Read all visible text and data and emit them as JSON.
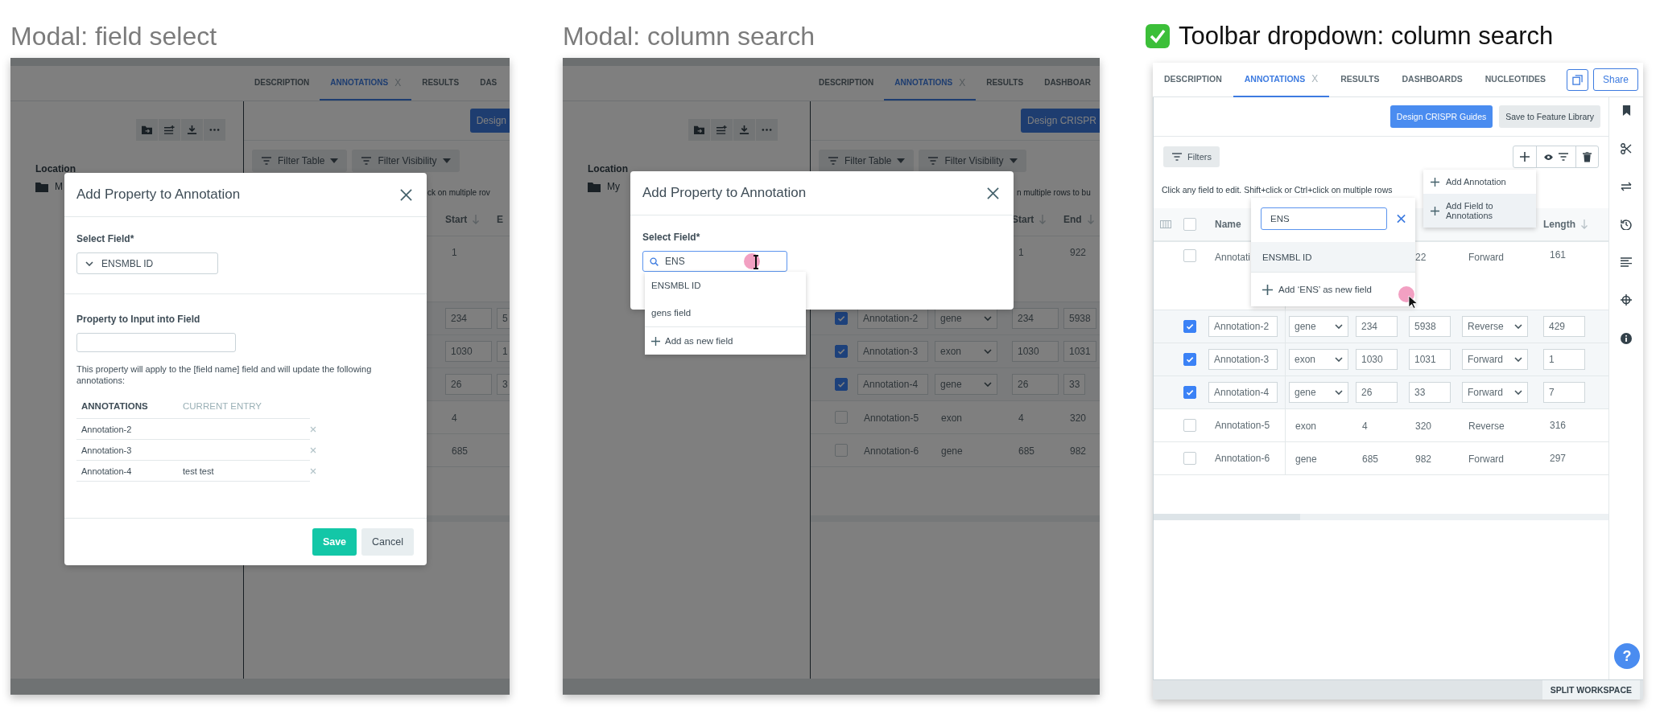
{
  "field_select": {
    "heading": "Modal: field select",
    "tabs": [
      {
        "label": "DESCRIPTION",
        "selected": false
      },
      {
        "label": "ANNOTATIONS",
        "selected": true,
        "close": "X"
      },
      {
        "label": "RESULTS",
        "selected": false
      },
      {
        "label": "DAS",
        "selected": false
      }
    ],
    "primary_button": "Design",
    "location_label": "Location",
    "folder": "M",
    "filters": [
      "Filter Table",
      "Filter Visibility"
    ],
    "hint": "ck on multiple rov",
    "columns": [
      {
        "label": "Start",
        "sort": true
      },
      {
        "label": "E",
        "sort": false
      }
    ],
    "rows": [
      {
        "editable": false,
        "start": "1"
      },
      {
        "editable": true,
        "start": "234",
        "end": "5"
      },
      {
        "editable": true,
        "start": "1030",
        "end": "1"
      },
      {
        "editable": true,
        "start": "26",
        "end": "3"
      },
      {
        "editable": false,
        "start": "4"
      },
      {
        "editable": false,
        "start": "685"
      }
    ],
    "modal": {
      "title": "Add Property to Annotation",
      "select_label": "Select Field*",
      "select_value": "ENSMBL ID",
      "input_label": "Property to Input into Field",
      "note": "This property will apply to the [field name] field and will update the following annotations:",
      "columns": [
        "ANNOTATIONS",
        "CURRENT ENTRY"
      ],
      "entries": [
        {
          "annotation": "Annotation-2"
        },
        {
          "annotation": "Annotation-3"
        },
        {
          "annotation": "Annotation-4",
          "current": "test test"
        }
      ],
      "buttons": [
        {
          "label": "Save",
          "kind": "primary"
        },
        {
          "label": "Cancel",
          "kind": "secondary"
        }
      ]
    }
  },
  "column_search": {
    "heading": "Modal: column search",
    "tabs": [
      {
        "label": "DESCRIPTION",
        "selected": false
      },
      {
        "label": "ANNOTATIONS",
        "selected": true,
        "close": "X"
      },
      {
        "label": "RESULTS",
        "selected": false
      },
      {
        "label": "DASHBOAR",
        "selected": false
      }
    ],
    "primary_button": "Design CRISPR",
    "location_label": "Location",
    "folder": "My",
    "filters": [
      "Filter Table",
      "Filter Visibility"
    ],
    "hint": "n multiple rows to bu",
    "columns": [
      {
        "label": "Start",
        "sort": true
      },
      {
        "label": "End",
        "sort": true
      }
    ],
    "rows": [
      {
        "editable": false,
        "start": "1",
        "end": "922"
      },
      {
        "checked": true,
        "editable": true,
        "name": "Annotation-2",
        "type": "gene",
        "start": "234",
        "end": "5938"
      },
      {
        "checked": true,
        "editable": true,
        "name": "Annotation-3",
        "type": "exon",
        "start": "1030",
        "end": "1031"
      },
      {
        "checked": true,
        "editable": true,
        "name": "Annotation-4",
        "type": "gene",
        "start": "26",
        "end": "33"
      },
      {
        "checked": false,
        "editable": false,
        "name": "Annotation-5",
        "type": "exon",
        "start": "4",
        "end": "320"
      },
      {
        "checked": false,
        "editable": false,
        "name": "Annotation-6",
        "type": "gene",
        "start": "685",
        "end": "982"
      }
    ],
    "modal": {
      "title": "Add Property to Annotation",
      "select_label": "Select Field*",
      "search_value": "ENS",
      "options": [
        {
          "label": "ENSMBL ID"
        },
        {
          "label": "gens field"
        }
      ],
      "add_option": "Add as new field"
    }
  },
  "toolbar_dropdown": {
    "heading": "Toolbar dropdown: column search",
    "approved": true,
    "tabs": [
      {
        "label": "DESCRIPTION",
        "selected": false
      },
      {
        "label": "ANNOTATIONS",
        "selected": true,
        "close": "X"
      },
      {
        "label": "RESULTS",
        "selected": false
      },
      {
        "label": "DASHBOARDS",
        "selected": false
      },
      {
        "label": "NUCLEOTIDES",
        "selected": false
      }
    ],
    "share": "Share",
    "actions": [
      {
        "label": "Design CRISPR Guides",
        "kind": "primary"
      },
      {
        "label": "Save to Feature Library",
        "kind": "secondary"
      }
    ],
    "filters": "Filters",
    "hint": "Click any field to edit. Shift+click or Ctrl+click on multiple rows",
    "header_checked": false,
    "name_column": "Name",
    "length_column": "Length",
    "rows": [
      {
        "checked": false,
        "editable": false,
        "name": "Annotati",
        "end": "22",
        "strand": "Forward",
        "length": "161"
      },
      {
        "checked": true,
        "editable": true,
        "name": "Annotation-2",
        "type": "gene",
        "start": "234",
        "end": "5938",
        "strand": "Reverse",
        "length": "429"
      },
      {
        "checked": true,
        "editable": true,
        "name": "Annotation-3",
        "type": "exon",
        "start": "1030",
        "end": "1031",
        "strand": "Forward",
        "length": "1"
      },
      {
        "checked": true,
        "editable": true,
        "name": "Annotation-4",
        "type": "gene",
        "start": "26",
        "end": "33",
        "strand": "Forward",
        "length": "7"
      },
      {
        "checked": false,
        "editable": false,
        "name": "Annotation-5",
        "type": "exon",
        "start": "4",
        "end": "320",
        "strand": "Reverse",
        "length": "316"
      },
      {
        "checked": false,
        "editable": false,
        "name": "Annotation-6",
        "type": "gene",
        "start": "685",
        "end": "982",
        "strand": "Forward",
        "length": "297"
      }
    ],
    "menu": [
      {
        "label": "Add Annotation",
        "selected": false
      },
      {
        "label": "Add Field to Annotations",
        "selected": true
      }
    ],
    "search": {
      "value": "ENS",
      "results": [
        {
          "label": "ENSMBL ID",
          "selected": true
        }
      ],
      "add_option": "Add ‘ENS’ as new field"
    },
    "footer_button": "SPLIT WORKSPACE",
    "help": "?"
  }
}
